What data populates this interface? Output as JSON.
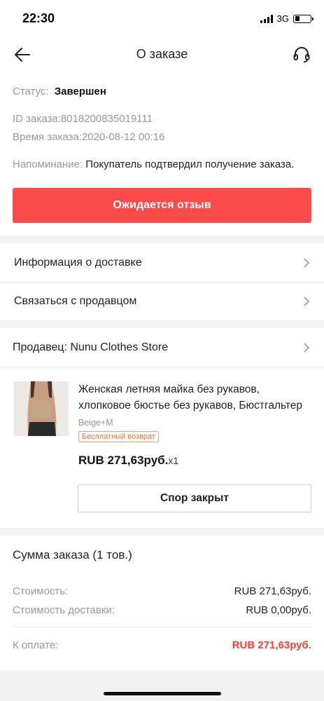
{
  "status_bar": {
    "time": "22:30",
    "network": "3G"
  },
  "nav": {
    "title": "О заказе"
  },
  "order": {
    "status_label": "Статус:",
    "status_value": "Завершен",
    "id_line": "ID заказа:8018200835019111",
    "time_line": "Время заказа:2020-08-12 00:16",
    "reminder_label": "Напоминание:",
    "reminder_text": " Покупатель подтвердил получение заказа.",
    "primary_button": "Ожидается отзыв"
  },
  "links": {
    "delivery": "Информация о доставке",
    "contact_seller": "Связаться с продавцом"
  },
  "seller": {
    "label": "Продавец: Nunu Clothes Store"
  },
  "product": {
    "title": "Женская летняя майка без рукавов, хлопковое бюстье без рукавов, Бюстгальтер",
    "variant": "Beige+M",
    "badge": "Бесплатный возврат",
    "price": "RUB 271,63руб.",
    "qty": "x1",
    "dispute_button": "Спор закрыт"
  },
  "summary": {
    "title": "Сумма заказа (1 тов.)",
    "cost_label": "Стоимость:",
    "cost_value": "RUB 271,63руб.",
    "shipping_label": "Стоимость доставки:",
    "shipping_value": "RUB 0,00руб.",
    "total_label": "К оплате:",
    "total_value": "RUB 271,63руб."
  },
  "colors": {
    "accent": "#ff4a4c",
    "total": "#ff3b30",
    "badge": "#ff6d2a"
  }
}
